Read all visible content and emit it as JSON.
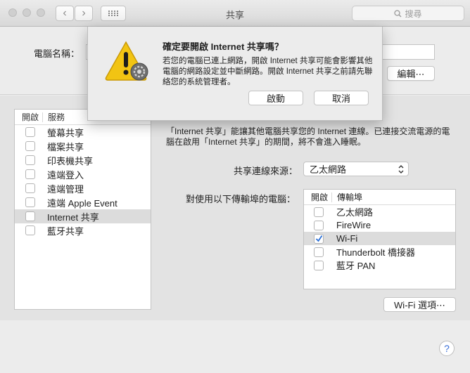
{
  "window": {
    "title": "共享"
  },
  "search": {
    "placeholder": "搜尋"
  },
  "computer_name": {
    "label": "電腦名稱：",
    "value": ""
  },
  "edit_button": "編輯⋯",
  "services": {
    "header_on": "開啟",
    "header_service": "服務",
    "items": [
      {
        "label": "螢幕共享",
        "checked": false,
        "selected": false
      },
      {
        "label": "檔案共享",
        "checked": false,
        "selected": false
      },
      {
        "label": "印表機共享",
        "checked": false,
        "selected": false
      },
      {
        "label": "遠端登入",
        "checked": false,
        "selected": false
      },
      {
        "label": "遠端管理",
        "checked": false,
        "selected": false
      },
      {
        "label": "遠端 Apple Event",
        "checked": false,
        "selected": false
      },
      {
        "label": "Internet 共享",
        "checked": false,
        "selected": true
      },
      {
        "label": "藍牙共享",
        "checked": false,
        "selected": false
      }
    ]
  },
  "description": "「Internet 共享」能讓其他電腦共享您的 Internet 連線。已連接交流電源的電腦在啟用「Internet 共享」的期間，將不會進入睡眠。",
  "source": {
    "label": "共享連線來源：",
    "value": "乙太網路"
  },
  "ports": {
    "label": "對使用以下傳輸埠的電腦：",
    "header_on": "開啟",
    "header_port": "傳輸埠",
    "items": [
      {
        "label": "乙太網路",
        "checked": false,
        "selected": false
      },
      {
        "label": "FireWire",
        "checked": false,
        "selected": false
      },
      {
        "label": "Wi-Fi",
        "checked": true,
        "selected": true
      },
      {
        "label": "Thunderbolt 橋接器",
        "checked": false,
        "selected": false
      },
      {
        "label": "藍牙 PAN",
        "checked": false,
        "selected": false
      }
    ]
  },
  "wifi_options_button": "Wi-Fi 選項⋯",
  "help_button": "?",
  "sheet": {
    "title": "確定要開啟 Internet 共享嗎？",
    "message": "若您的電腦已連上網路，開啟 Internet 共享可能會影響其他電腦的網路設定並中斷網路。開啟 Internet 共享之前請先聯絡您的系統管理者。",
    "start_button": "啟動",
    "cancel_button": "取消"
  },
  "colors": {
    "checkmark": "#2a6fd6",
    "warning": "#f2c413",
    "selection": "#dcdcdc"
  }
}
